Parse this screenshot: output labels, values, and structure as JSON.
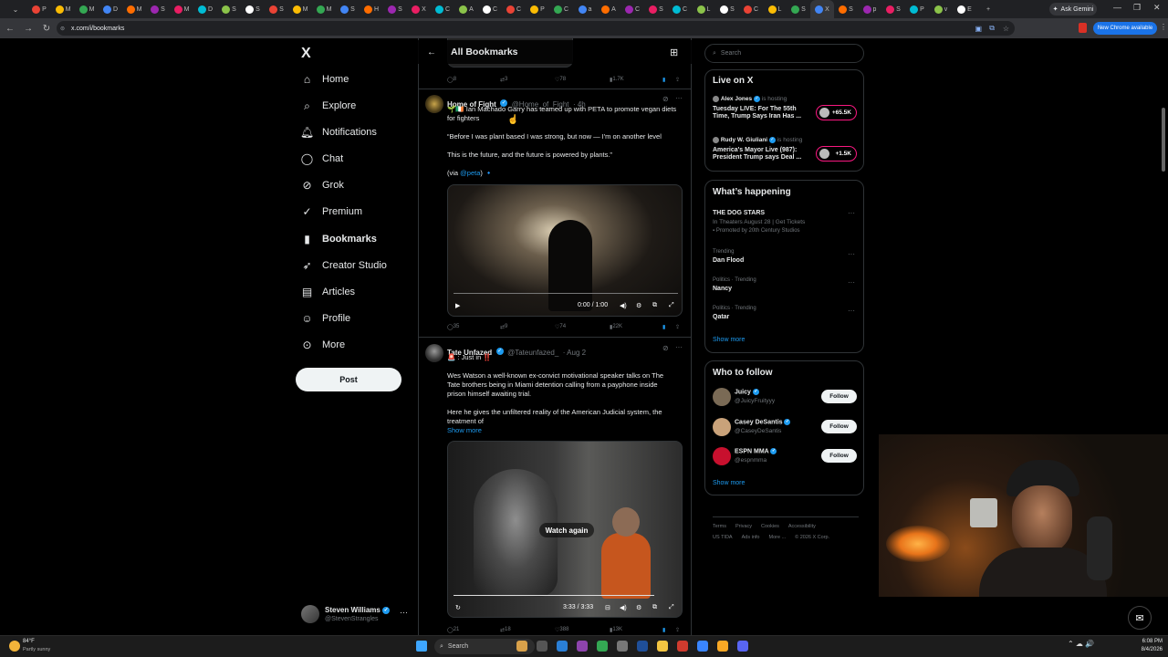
{
  "browser": {
    "url": "x.com/i/bookmarks",
    "gemini_label": "Ask Gemini",
    "update_label": "New Chrome available",
    "tab_icons": [
      "tab",
      "tab",
      "tab",
      "tab",
      "tab",
      "tab",
      "tab",
      "tab",
      "tab",
      "tab",
      "tab",
      "tab",
      "tab",
      "tab",
      "tab",
      "tab",
      "tab",
      "tab",
      "tab",
      "tab",
      "tab",
      "tab",
      "tab",
      "tab",
      "tab",
      "tab",
      "tab",
      "tab",
      "tab",
      "tab",
      "tab",
      "tab",
      "tab",
      "tab",
      "tab",
      "tab",
      "tab",
      "tab",
      "tab",
      "tab",
      "tab",
      "tab"
    ],
    "tab_letters": [
      "P",
      "M",
      "M",
      "D",
      "M",
      "S",
      "M",
      "D",
      "S",
      "S",
      "S",
      "M",
      "M",
      "S",
      "H",
      "S",
      "X",
      "C",
      "A",
      "C",
      "C",
      "P",
      "C",
      "a",
      "A",
      "C",
      "S",
      "C",
      "L",
      "S",
      "C",
      "L",
      "S",
      "X",
      "S",
      "p",
      "S",
      "P",
      "v",
      "E"
    ]
  },
  "sidebar": {
    "logo": "X",
    "items": [
      {
        "label": "Home",
        "icon": "home-icon"
      },
      {
        "label": "Explore",
        "icon": "search-icon"
      },
      {
        "label": "Notifications",
        "icon": "bell-icon"
      },
      {
        "label": "Chat",
        "icon": "chat-icon"
      },
      {
        "label": "Grok",
        "icon": "grok-icon"
      },
      {
        "label": "Premium",
        "icon": "premium-icon"
      },
      {
        "label": "Bookmarks",
        "icon": "bookmark-icon"
      },
      {
        "label": "Creator Studio",
        "icon": "rocket-icon"
      },
      {
        "label": "Articles",
        "icon": "article-icon"
      },
      {
        "label": "Profile",
        "icon": "person-icon"
      },
      {
        "label": "More",
        "icon": "more-circle-icon"
      }
    ],
    "post_label": "Post",
    "account": {
      "name": "Steven Williams",
      "handle": "@StevenStrangles"
    }
  },
  "header": {
    "title": "All Bookmarks"
  },
  "tweets": [
    {
      "stats": {
        "replies": "8",
        "reposts": "3",
        "likes": "78",
        "views": "1.7K"
      }
    },
    {
      "name": "Home of Fight",
      "handle": "@Home_of_Fight",
      "time": "· 4h",
      "text_line1": "🌱🇮🇪 Ian Machado Garry has teamed up with PETA to promote vegan diets",
      "text_line2": "for fighters",
      "quote1": "“Before I was plant based I was strong, but now — I'm on another level",
      "quote2": "This is the future, and the future is powered by plants.”",
      "via_prefix": "(via ",
      "via_link": "@peta",
      "via_suffix": ") 🔹",
      "video_time": "0:00 / 1:00",
      "stats": {
        "replies": "35",
        "reposts": "9",
        "likes": "74",
        "views": "22K"
      }
    },
    {
      "name": "Tate Unfazed",
      "handle": "@Tateunfazed_",
      "time": "· Aug 2",
      "text_line1": "🚨 : Just in ‼️",
      "p1_line1": "Wes Watson a well-known ex-convict motivational speaker talks on The",
      "p1_line2": "Tate brothers being in Miami detention calling from a payphone inside",
      "p1_line3": "prison himself awaiting trial.",
      "p2_line1": "Here he gives the unfiltered reality of the American Judicial system, the",
      "p2_line2": "treatment of",
      "show_more": "Show more",
      "video_overlay": "Watch again",
      "video_time": "3:33 / 3:33",
      "stats": {
        "replies": "21",
        "reposts": "18",
        "likes": "388",
        "views": "13K"
      }
    }
  ],
  "right": {
    "search_placeholder": "Search",
    "live": {
      "title": "Live on X",
      "items": [
        {
          "host": "Alex Jones",
          "status": "is hosting",
          "title1": "Tuesday LIVE: For The 55th",
          "title2": "Time, Trump Says Iran Has ...",
          "count": "+65.5K"
        },
        {
          "host": "Rudy W. Giuliani",
          "status": "is hosting",
          "title1": "America's Mayor Live (987):",
          "title2": "President Trump says Deal ...",
          "count": "+1.5K"
        }
      ]
    },
    "happening": {
      "title": "What’s happening",
      "items": [
        {
          "meta": "",
          "title": "THE DOG STARS",
          "sub": "In Theaters August 28 | Get Tickets",
          "sub2": "Promoted by 20th Century Studios"
        },
        {
          "meta": "Trending",
          "title": "Dan Flood"
        },
        {
          "meta": "Politics · Trending",
          "title": "Nancy"
        },
        {
          "meta": "Politics · Trending",
          "title": "Qatar"
        }
      ],
      "show_more": "Show more"
    },
    "follow": {
      "title": "Who to follow",
      "items": [
        {
          "name": "Juicy",
          "handle": "@JuicyFruityyy",
          "button": "Follow"
        },
        {
          "name": "Casey DeSantis",
          "handle": "@CaseyDeSantis",
          "button": "Follow"
        },
        {
          "name": "ESPN MMA",
          "handle": "@espnmma",
          "button": "Follow"
        }
      ],
      "show_more": "Show more"
    },
    "footer": {
      "links1": [
        "Terms",
        "Privacy",
        "Cookies",
        "Accessibility"
      ],
      "links2": [
        "US TIDA",
        "Ads info",
        "More ...",
        "© 2026 X Corp."
      ]
    }
  },
  "taskbar": {
    "weather_temp": "84°F",
    "weather_desc": "Partly sunny",
    "search_label": "Search",
    "time": "6:08 PM",
    "date": "8/4/2026"
  },
  "colors": {
    "accent": "#1d9bf0",
    "background": "#000000",
    "border": "#2f3336",
    "live_pink": "#f91880"
  }
}
